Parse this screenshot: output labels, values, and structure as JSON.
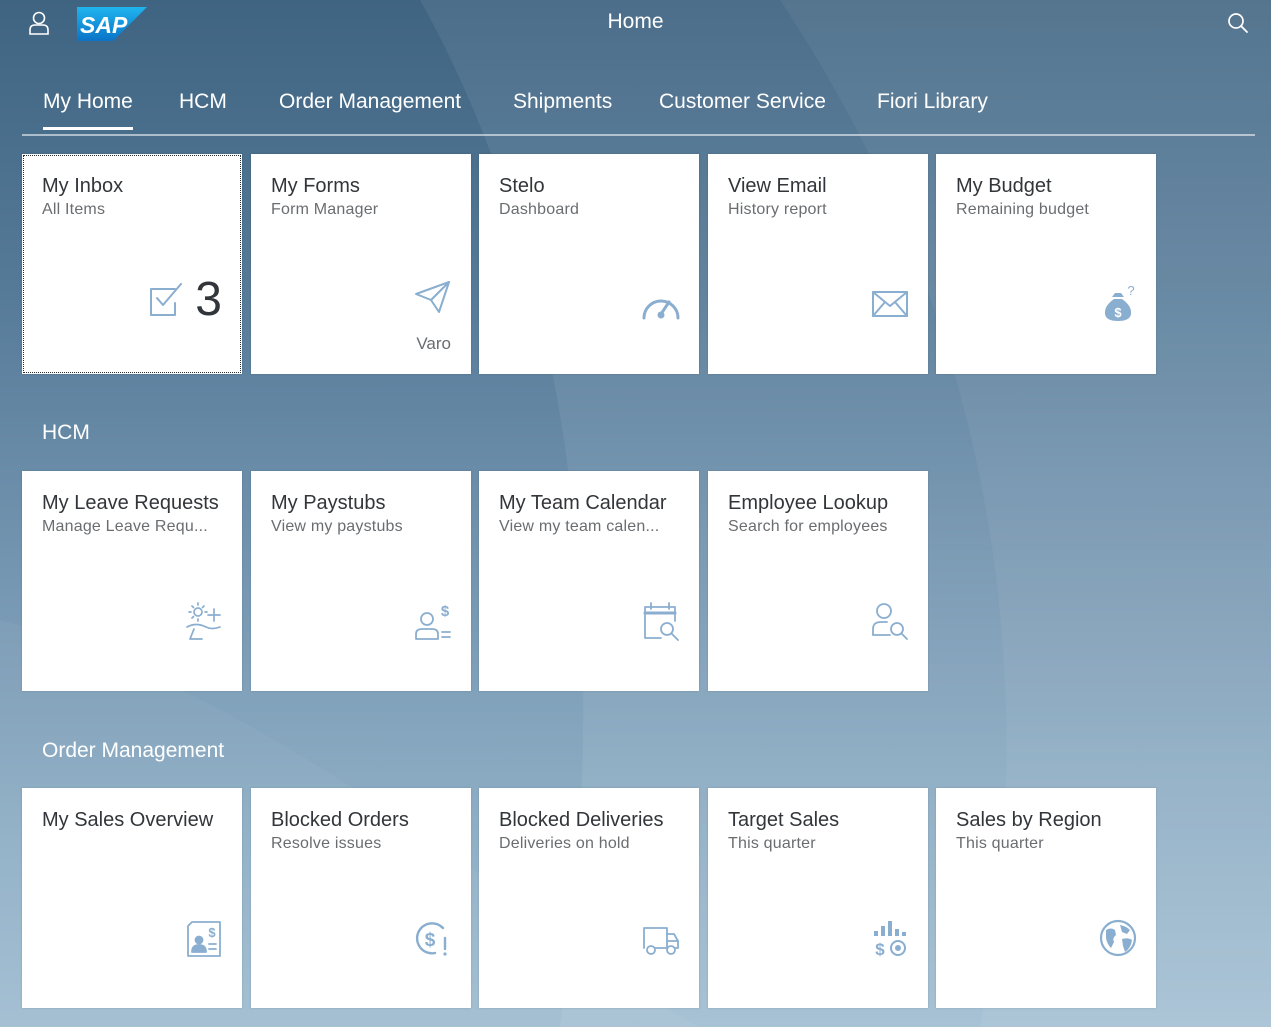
{
  "shell": {
    "title": "Home",
    "logo_text": "SAP",
    "colors": {
      "tile_icon": "#8aaed0",
      "tile_title": "#32363a",
      "tile_subtitle": "#6a6d70"
    }
  },
  "tabs": [
    {
      "label": "My Home",
      "active": true
    },
    {
      "label": "HCM"
    },
    {
      "label": "Order Management"
    },
    {
      "label": "Shipments"
    },
    {
      "label": "Customer Service"
    },
    {
      "label": "Fiori Library"
    }
  ],
  "groups": {
    "home": {
      "tiles": [
        {
          "title": "My Inbox",
          "subtitle": "All Items",
          "kpi": "3",
          "icon": "task-icon"
        },
        {
          "title": "My Forms",
          "subtitle": "Form Manager",
          "footer": "Varo",
          "icon": "paper-plane-icon"
        },
        {
          "title": "Stelo",
          "subtitle": "Dashboard",
          "icon": "speedometer-icon"
        },
        {
          "title": "View Email",
          "subtitle": "History report",
          "icon": "envelope-icon"
        },
        {
          "title": "My Budget",
          "subtitle": "Remaining budget",
          "icon": "money-bag-icon"
        }
      ]
    },
    "hcm": {
      "title": "HCM",
      "tiles": [
        {
          "title": "My Leave Requests",
          "subtitle": "Manage Leave Requ...",
          "icon": "vacation-icon"
        },
        {
          "title": "My Paystubs",
          "subtitle": "View my paystubs",
          "icon": "paystub-icon"
        },
        {
          "title": "My Team Calendar",
          "subtitle": "View my team calen...",
          "icon": "calendar-search-icon"
        },
        {
          "title": "Employee Lookup",
          "subtitle": "Search for employees",
          "icon": "employee-lookup-icon"
        }
      ]
    },
    "order": {
      "title": "Order Management",
      "tiles": [
        {
          "title": "My Sales Overview",
          "subtitle": "",
          "icon": "sales-document-icon"
        },
        {
          "title": "Blocked Orders",
          "subtitle": "Resolve issues",
          "icon": "blocked-money-icon"
        },
        {
          "title": "Blocked Deliveries",
          "subtitle": "Deliveries on hold",
          "icon": "delivery-truck-icon"
        },
        {
          "title": "Target Sales",
          "subtitle": "This quarter",
          "icon": "target-sales-icon"
        },
        {
          "title": "Sales by Region",
          "subtitle": "This quarter",
          "icon": "globe-icon"
        }
      ]
    }
  }
}
